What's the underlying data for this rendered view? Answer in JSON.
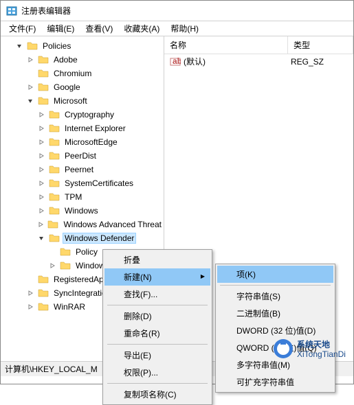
{
  "window": {
    "title": "注册表编辑器"
  },
  "menubar": [
    "文件(F)",
    "编辑(E)",
    "查看(V)",
    "收藏夹(A)",
    "帮助(H)"
  ],
  "tree": [
    {
      "label": "Policies",
      "indent": 1,
      "toggle": "open",
      "selected": false
    },
    {
      "label": "Adobe",
      "indent": 2,
      "toggle": "closed",
      "selected": false
    },
    {
      "label": "Chromium",
      "indent": 2,
      "toggle": "none",
      "selected": false
    },
    {
      "label": "Google",
      "indent": 2,
      "toggle": "closed",
      "selected": false
    },
    {
      "label": "Microsoft",
      "indent": 2,
      "toggle": "open",
      "selected": false
    },
    {
      "label": "Cryptography",
      "indent": 3,
      "toggle": "closed",
      "selected": false
    },
    {
      "label": "Internet Explorer",
      "indent": 3,
      "toggle": "closed",
      "selected": false
    },
    {
      "label": "MicrosoftEdge",
      "indent": 3,
      "toggle": "closed",
      "selected": false
    },
    {
      "label": "PeerDist",
      "indent": 3,
      "toggle": "closed",
      "selected": false
    },
    {
      "label": "Peernet",
      "indent": 3,
      "toggle": "closed",
      "selected": false
    },
    {
      "label": "SystemCertificates",
      "indent": 3,
      "toggle": "closed",
      "selected": false
    },
    {
      "label": "TPM",
      "indent": 3,
      "toggle": "closed",
      "selected": false
    },
    {
      "label": "Windows",
      "indent": 3,
      "toggle": "closed",
      "selected": false
    },
    {
      "label": "Windows Advanced Threat",
      "indent": 3,
      "toggle": "closed",
      "selected": false
    },
    {
      "label": "Windows Defender",
      "indent": 3,
      "toggle": "open",
      "selected": true
    },
    {
      "label": "Policy",
      "indent": 4,
      "toggle": "none",
      "selected": false
    },
    {
      "label": "Windows",
      "indent": 4,
      "toggle": "closed",
      "selected": false
    },
    {
      "label": "RegisteredApplications",
      "indent": 2,
      "toggle": "none",
      "selected": false
    },
    {
      "label": "SyncIntegration",
      "indent": 2,
      "toggle": "closed",
      "selected": false
    },
    {
      "label": "WinRAR",
      "indent": 2,
      "toggle": "closed",
      "selected": false
    }
  ],
  "list": {
    "columns": {
      "name": "名称",
      "type": "类型"
    },
    "rows": [
      {
        "name": "(默认)",
        "type": "REG_SZ"
      }
    ]
  },
  "statusbar": {
    "path": "计算机\\HKEY_LOCAL_M"
  },
  "contextMenu1": {
    "items": [
      {
        "label": "折叠",
        "type": "item"
      },
      {
        "label": "新建(N)",
        "type": "item",
        "highlighted": true,
        "sub": true
      },
      {
        "label": "查找(F)...",
        "type": "item"
      },
      {
        "type": "sep"
      },
      {
        "label": "删除(D)",
        "type": "item"
      },
      {
        "label": "重命名(R)",
        "type": "item"
      },
      {
        "type": "sep"
      },
      {
        "label": "导出(E)",
        "type": "item"
      },
      {
        "label": "权限(P)...",
        "type": "item"
      },
      {
        "type": "sep"
      },
      {
        "label": "复制项名称(C)",
        "type": "item"
      }
    ]
  },
  "contextMenu2": {
    "items": [
      {
        "label": "项(K)",
        "type": "item",
        "highlighted": true
      },
      {
        "type": "sep"
      },
      {
        "label": "字符串值(S)",
        "type": "item"
      },
      {
        "label": "二进制值(B)",
        "type": "item"
      },
      {
        "label": "DWORD (32 位)值(D)",
        "type": "item"
      },
      {
        "label": "QWORD (64 位)值(Q)",
        "type": "item"
      },
      {
        "label": "多字符串值(M)",
        "type": "item"
      },
      {
        "label": "可扩充字符串值",
        "type": "item"
      }
    ]
  },
  "watermark": {
    "line1": "系统天地",
    "line2": "XiTongTianDi.net"
  }
}
